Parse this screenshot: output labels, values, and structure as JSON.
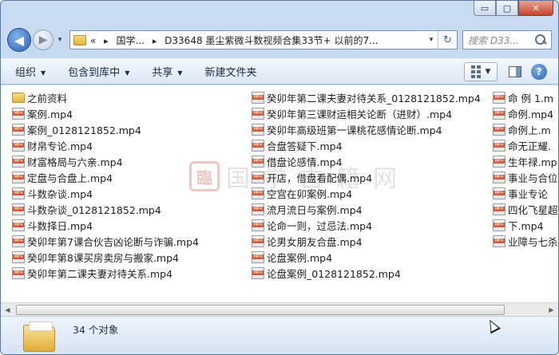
{
  "window": {
    "minimize_label": "▭",
    "maximize_label": "▢",
    "close_label": "✕"
  },
  "nav": {
    "back_label": "◀",
    "forward_label": "▶",
    "history_label": "▾"
  },
  "address": {
    "prefix": "«",
    "segments": [
      "国学...",
      "D33648 墨尘紫微斗数视频合集33节+ 以前的7..."
    ],
    "separator": "▸",
    "dropdown_label": "▾",
    "refresh_label": "↻"
  },
  "search": {
    "placeholder": "搜索 D33..."
  },
  "toolbar": {
    "organize": "组织",
    "include_library": "包含到库中",
    "share": "共享",
    "new_folder": "新建文件夹",
    "caret": "▼"
  },
  "watermark": {
    "seal": "臨",
    "text": "国学古籍网"
  },
  "files": {
    "col1": [
      {
        "name": "之前资料",
        "type": "folder"
      },
      {
        "name": "案例.mp4",
        "type": "video"
      },
      {
        "name": "案例_0128121852.mp4",
        "type": "video"
      },
      {
        "name": "财帛专论.mp4",
        "type": "video"
      },
      {
        "name": "财富格局与六亲.mp4",
        "type": "video"
      },
      {
        "name": "定盘与合盘上.mp4",
        "type": "video"
      },
      {
        "name": "斗数杂谈.mp4",
        "type": "video"
      },
      {
        "name": "斗数杂谈_0128121852.mp4",
        "type": "video"
      },
      {
        "name": "斗数择日.mp4",
        "type": "video"
      },
      {
        "name": "癸卯年第7课合伙吉凶论断与诈骗.mp4",
        "type": "video"
      },
      {
        "name": "癸卯年第8课买房卖房与搬家.mp4",
        "type": "video"
      },
      {
        "name": "癸卯年第二课夫妻对待关系.mp4",
        "type": "video"
      }
    ],
    "col2": [
      {
        "name": "癸卯年第二课夫妻对待关系_0128121852.mp4",
        "type": "video"
      },
      {
        "name": "癸卯年第三课财运相关论断（进财）.mp4",
        "type": "video"
      },
      {
        "name": "癸卯年高级班第一课桃花感情论断.mp4",
        "type": "video"
      },
      {
        "name": "合盘答疑下.mp4",
        "type": "video"
      },
      {
        "name": "借盘论感情.mp4",
        "type": "video"
      },
      {
        "name": "开店，借盘看配偶.mp4",
        "type": "video"
      },
      {
        "name": "空宫在卯案例.mp4",
        "type": "video"
      },
      {
        "name": "流月流日与案例.mp4",
        "type": "video"
      },
      {
        "name": "论命一则，过忌法.mp4",
        "type": "video"
      },
      {
        "name": "论男女朋友合盘.mp4",
        "type": "video"
      },
      {
        "name": "论盘案例.mp4",
        "type": "video"
      },
      {
        "name": "论盘案例_0128121852.mp4",
        "type": "video"
      }
    ],
    "col3": [
      {
        "name": "命 例 1.m",
        "type": "video"
      },
      {
        "name": "命例.mp4",
        "type": "video"
      },
      {
        "name": "命例上.m",
        "type": "video"
      },
      {
        "name": "命无正耀.",
        "type": "video"
      },
      {
        "name": "生年禄.mp",
        "type": "video"
      },
      {
        "name": "事业与合位",
        "type": "video"
      },
      {
        "name": "事业专论",
        "type": "video"
      },
      {
        "name": "四化飞星超",
        "type": "video"
      },
      {
        "name": "下.mp4",
        "type": "video"
      },
      {
        "name": "业障与七杀",
        "type": "video"
      }
    ]
  },
  "scrollbar": {
    "left_label": "◀",
    "right_label": "▶"
  },
  "details": {
    "count": "34 个对象"
  }
}
